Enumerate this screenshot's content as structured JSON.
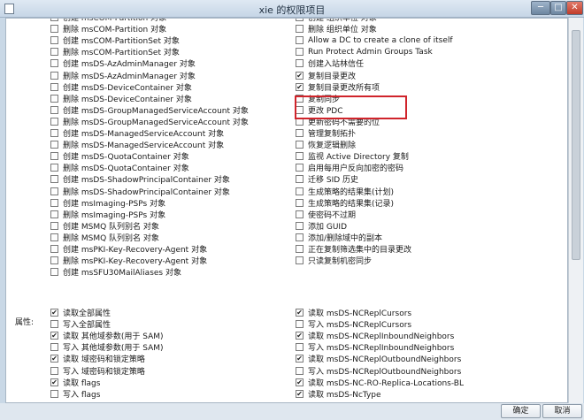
{
  "window": {
    "title": "xie 的权限项目",
    "controls": [
      "─",
      "□",
      "✕"
    ]
  },
  "object_left": [
    {
      "label": "创建 msCOM-Partition 对象",
      "checked": false
    },
    {
      "label": "删除 msCOM-Partition 对象",
      "checked": false
    },
    {
      "label": "创建 msCOM-PartitionSet 对象",
      "checked": false
    },
    {
      "label": "删除 msCOM-PartitionSet 对象",
      "checked": false
    },
    {
      "label": "创建 msDS-AzAdminManager 对象",
      "checked": false
    },
    {
      "label": "删除 msDS-AzAdminManager 对象",
      "checked": false
    },
    {
      "label": "创建 msDS-DeviceContainer 对象",
      "checked": false
    },
    {
      "label": "删除 msDS-DeviceContainer 对象",
      "checked": false
    },
    {
      "label": "创建 msDS-GroupManagedServiceAccount 对象",
      "checked": false
    },
    {
      "label": "删除 msDS-GroupManagedServiceAccount 对象",
      "checked": false
    },
    {
      "label": "创建 msDS-ManagedServiceAccount 对象",
      "checked": false
    },
    {
      "label": "删除 msDS-ManagedServiceAccount 对象",
      "checked": false
    },
    {
      "label": "创建 msDS-QuotaContainer 对象",
      "checked": false
    },
    {
      "label": "删除 msDS-QuotaContainer 对象",
      "checked": false
    },
    {
      "label": "创建 msDS-ShadowPrincipalContainer 对象",
      "checked": false
    },
    {
      "label": "删除 msDS-ShadowPrincipalContainer 对象",
      "checked": false
    },
    {
      "label": "创建 msImaging-PSPs 对象",
      "checked": false
    },
    {
      "label": "删除 msImaging-PSPs 对象",
      "checked": false
    },
    {
      "label": "创建 MSMQ 队列别名 对象",
      "checked": false
    },
    {
      "label": "删除 MSMQ 队列别名 对象",
      "checked": false
    },
    {
      "label": "创建 msPKI-Key-Recovery-Agent 对象",
      "checked": false
    },
    {
      "label": "删除 msPKI-Key-Recovery-Agent 对象",
      "checked": false
    },
    {
      "label": "创建 msSFU30MailAliases 对象",
      "checked": false
    }
  ],
  "object_right": [
    {
      "label": "创建 组织单位 对象",
      "checked": false
    },
    {
      "label": "删除 组织单位 对象",
      "checked": false
    },
    {
      "label": "Allow a DC to create a clone of itself",
      "checked": false
    },
    {
      "label": "Run Protect Admin Groups Task",
      "checked": false
    },
    {
      "label": "创建入站林信任",
      "checked": false
    },
    {
      "label": "复制目录更改",
      "checked": true
    },
    {
      "label": "复制目录更改所有项",
      "checked": true
    },
    {
      "label": "复制同步",
      "checked": false
    },
    {
      "label": "更改 PDC",
      "checked": false
    },
    {
      "label": "更新密码不需要的位",
      "checked": false
    },
    {
      "label": "管理复制拓扑",
      "checked": false
    },
    {
      "label": "恢复逻辑删除",
      "checked": false
    },
    {
      "label": "监视 Active Directory 复制",
      "checked": false
    },
    {
      "label": "启用每用户反向加密的密码",
      "checked": false
    },
    {
      "label": "迁移 SID 历史",
      "checked": false
    },
    {
      "label": "生成策略的结果集(计划)",
      "checked": false
    },
    {
      "label": "生成策略的结果集(记录)",
      "checked": false
    },
    {
      "label": "使密码不过期",
      "checked": false
    },
    {
      "label": "添加 GUID",
      "checked": false
    },
    {
      "label": "添加/删除域中的副本",
      "checked": false
    },
    {
      "label": "正在复制筛选集中的目录更改",
      "checked": false
    },
    {
      "label": "只读复制机密同步",
      "checked": false
    }
  ],
  "properties_label": "属性:",
  "props_left": [
    {
      "label": "读取全部属性",
      "checked": true
    },
    {
      "label": "写入全部属性",
      "checked": false
    },
    {
      "label": "读取 其他域参数(用于 SAM)",
      "checked": true
    },
    {
      "label": "写入 其他域参数(用于 SAM)",
      "checked": false
    },
    {
      "label": "读取 域密码和锁定策略",
      "checked": true
    },
    {
      "label": "写入 域密码和锁定策略",
      "checked": false
    },
    {
      "label": "读取 flags",
      "checked": true
    },
    {
      "label": "写入 flags",
      "checked": false
    }
  ],
  "props_right": [
    {
      "label": "读取 msDS-NCReplCursors",
      "checked": true
    },
    {
      "label": "写入 msDS-NCReplCursors",
      "checked": false
    },
    {
      "label": "读取 msDS-NCReplInboundNeighbors",
      "checked": true
    },
    {
      "label": "写入 msDS-NCReplInboundNeighbors",
      "checked": false
    },
    {
      "label": "读取 msDS-NCReplOutboundNeighbors",
      "checked": true
    },
    {
      "label": "写入 msDS-NCReplOutboundNeighbors",
      "checked": false
    },
    {
      "label": "读取 msDS-NC-RO-Replica-Locations-BL",
      "checked": true
    },
    {
      "label": "读取 msDS-NcType",
      "checked": true
    }
  ],
  "footer": {
    "ok_label": "确定",
    "cancel_label": "取消"
  },
  "colors": {
    "highlight": "#d0242b",
    "titlebar": "#c6d6e6"
  }
}
